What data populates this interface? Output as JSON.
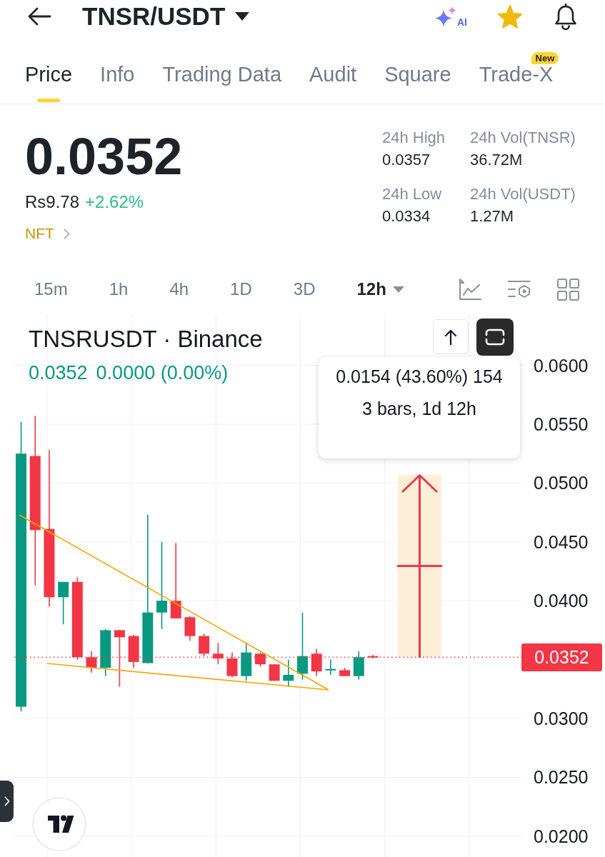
{
  "header": {
    "pair": "TNSR/USDT",
    "ai_label": "AI",
    "favorite": true
  },
  "tabs": [
    {
      "label": "Price",
      "selected": true
    },
    {
      "label": "Info",
      "selected": false
    },
    {
      "label": "Trading Data",
      "selected": false
    },
    {
      "label": "Audit",
      "selected": false
    },
    {
      "label": "Square",
      "selected": false
    },
    {
      "label": "Trade-X",
      "selected": false,
      "badge": "New"
    }
  ],
  "ticker": {
    "price": "0.0352",
    "fiat_price": "Rs9.78",
    "change": "+2.62%",
    "tag": "NFT",
    "stats": [
      {
        "label": "24h High",
        "value": "0.0357"
      },
      {
        "label": "24h Vol(TNSR)",
        "value": "36.72M"
      },
      {
        "label": "24h Low",
        "value": "0.0334"
      },
      {
        "label": "24h Vol(USDT)",
        "value": "1.27M"
      }
    ]
  },
  "intervals": [
    {
      "label": "15m",
      "selected": false,
      "dropdown": false
    },
    {
      "label": "1h",
      "selected": false,
      "dropdown": false
    },
    {
      "label": "4h",
      "selected": false,
      "dropdown": false
    },
    {
      "label": "1D",
      "selected": false,
      "dropdown": false
    },
    {
      "label": "3D",
      "selected": false,
      "dropdown": false
    },
    {
      "label": "12h",
      "selected": true,
      "dropdown": true
    }
  ],
  "chart": {
    "symbol": "TNSRUSDT · Binance",
    "last": "0.0352",
    "change": "0.0000 (0.00%)",
    "measure": {
      "change": "0.0154 (43.60%) 154",
      "span": "3 bars, 1d 12h"
    },
    "chart_data": {
      "type": "candlestick",
      "grid": true,
      "categories": [
        null,
        null,
        null,
        null,
        null,
        null,
        null,
        null,
        null,
        null,
        null,
        null,
        null,
        null,
        null,
        null,
        null,
        null,
        null,
        null,
        null,
        null,
        null,
        null,
        null,
        null,
        null,
        null,
        null,
        null,
        null,
        null,
        null,
        null,
        null,
        null,
        null,
        null,
        null,
        null,
        null,
        null,
        null
      ],
      "ohlc": [
        null,
        [
          0.031,
          0.0552,
          0.0306,
          0.0525
        ],
        [
          0.0523,
          0.0557,
          0.0413,
          0.046
        ],
        [
          0.0461,
          0.0528,
          0.0395,
          0.0403
        ],
        [
          0.0403,
          0.0416,
          0.038,
          0.0416
        ],
        [
          0.0416,
          0.042,
          0.035,
          0.0352
        ],
        [
          0.0352,
          0.0357,
          0.0339,
          0.0343
        ],
        [
          0.0343,
          0.0376,
          0.0336,
          0.0375
        ],
        [
          0.0375,
          0.0375,
          0.0327,
          0.0369
        ],
        [
          0.037,
          0.0371,
          0.0343,
          0.0348
        ],
        [
          0.0347,
          0.0473,
          0.0347,
          0.039
        ],
        [
          0.039,
          0.045,
          0.0376,
          0.04
        ],
        [
          0.04,
          0.0449,
          0.0385,
          0.0385
        ],
        [
          0.0386,
          0.0387,
          0.0366,
          0.037
        ],
        [
          0.037,
          0.0372,
          0.0353,
          0.0355
        ],
        [
          0.0355,
          0.0364,
          0.0346,
          0.0351
        ],
        [
          0.0351,
          0.0356,
          0.0335,
          0.0336
        ],
        [
          0.0336,
          0.0364,
          0.0332,
          0.0356
        ],
        [
          0.0355,
          0.0356,
          0.0344,
          0.0346
        ],
        [
          0.0346,
          0.0346,
          0.0332,
          0.0332
        ],
        [
          0.0332,
          0.035,
          0.0327,
          0.0337
        ],
        [
          0.0338,
          0.039,
          0.0333,
          0.0353
        ],
        [
          0.0355,
          0.0359,
          0.0336,
          0.034
        ],
        [
          0.0341,
          0.035,
          0.0337,
          0.0342
        ],
        [
          0.0341,
          0.0343,
          0.0336,
          0.0336
        ],
        [
          0.0336,
          0.0357,
          0.0333,
          0.0352
        ],
        [
          0.0353,
          0.0354,
          0.0351,
          0.0352
        ],
        null,
        null,
        null,
        null,
        null,
        null,
        null,
        null,
        null,
        null,
        null,
        null,
        null,
        null,
        null,
        null
      ],
      "ylim": [
        0.01823,
        0.06434
      ],
      "yticks": [
        {
          "value": 0.06,
          "label": "0.0600"
        },
        {
          "value": 0.055,
          "label": "0.0550"
        },
        {
          "value": 0.05,
          "label": "0.0500"
        },
        {
          "value": 0.045,
          "label": "0.0450"
        },
        {
          "value": 0.04,
          "label": "0.0400"
        },
        {
          "value": 0.03,
          "label": "0.0300"
        },
        {
          "value": 0.025,
          "label": "0.0250"
        },
        {
          "value": 0.02,
          "label": "0.0200"
        }
      ],
      "ref_lines": [
        {
          "axis": "y",
          "value": 0.0352,
          "label": "0.0352"
        }
      ]
    }
  }
}
